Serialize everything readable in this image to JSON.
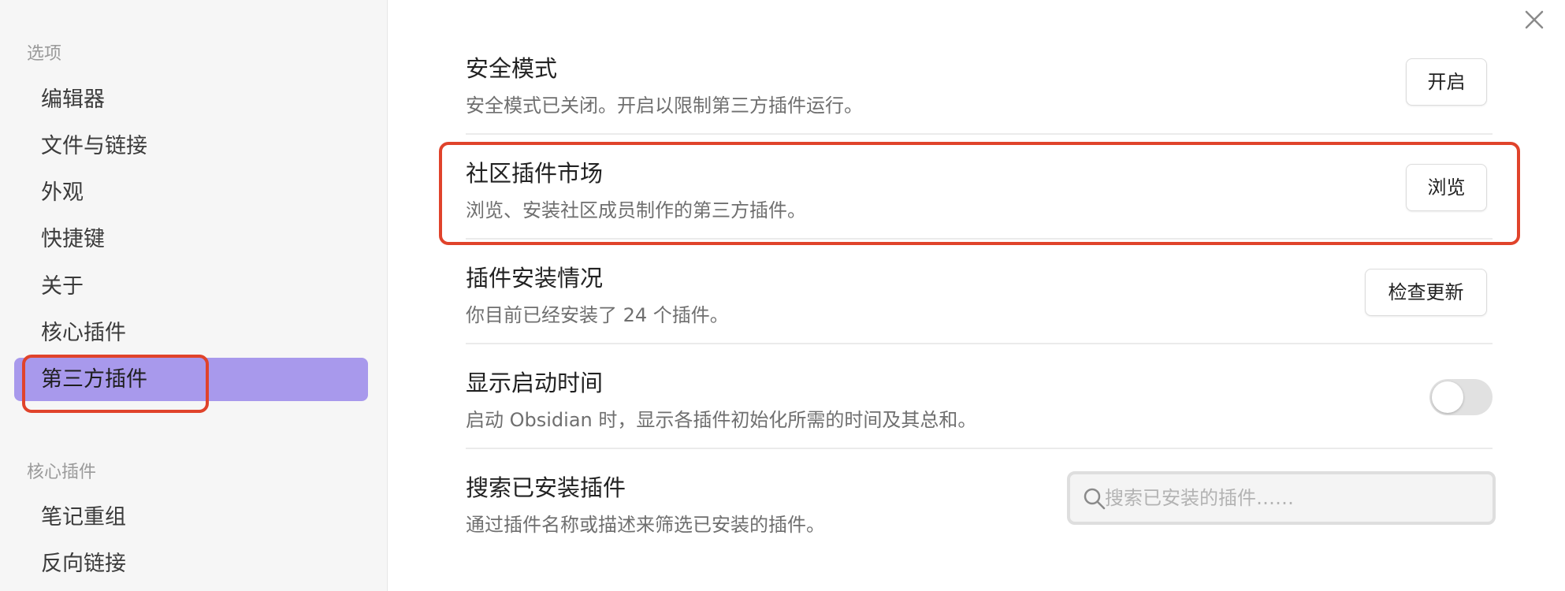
{
  "sidebar": {
    "options_title": "选项",
    "options_items": [
      {
        "label": "编辑器"
      },
      {
        "label": "文件与链接"
      },
      {
        "label": "外观"
      },
      {
        "label": "快捷键"
      },
      {
        "label": "关于"
      },
      {
        "label": "核心插件"
      },
      {
        "label": "第三方插件",
        "active": true
      }
    ],
    "core_title": "核心插件",
    "core_items": [
      {
        "label": "笔记重组"
      },
      {
        "label": "反向链接"
      }
    ]
  },
  "settings": {
    "safe_mode": {
      "name": "安全模式",
      "desc": "安全模式已关闭。开启以限制第三方插件运行。",
      "button": "开启"
    },
    "community": {
      "name": "社区插件市场",
      "desc": "浏览、安装社区成员制作的第三方插件。",
      "button": "浏览"
    },
    "installed": {
      "name": "插件安装情况",
      "desc": "你目前已经安装了 24 个插件。",
      "button": "检查更新"
    },
    "startup_time": {
      "name": "显示启动时间",
      "desc": "启动 Obsidian 时，显示各插件初始化所需的时间及其总和。",
      "enabled": false
    },
    "search": {
      "name": "搜索已安装插件",
      "desc": "通过插件名称或描述来筛选已安装的插件。",
      "placeholder": "搜索已安装的插件……"
    }
  },
  "colors": {
    "accent": "#a899ec",
    "highlight": "#e0432b"
  }
}
